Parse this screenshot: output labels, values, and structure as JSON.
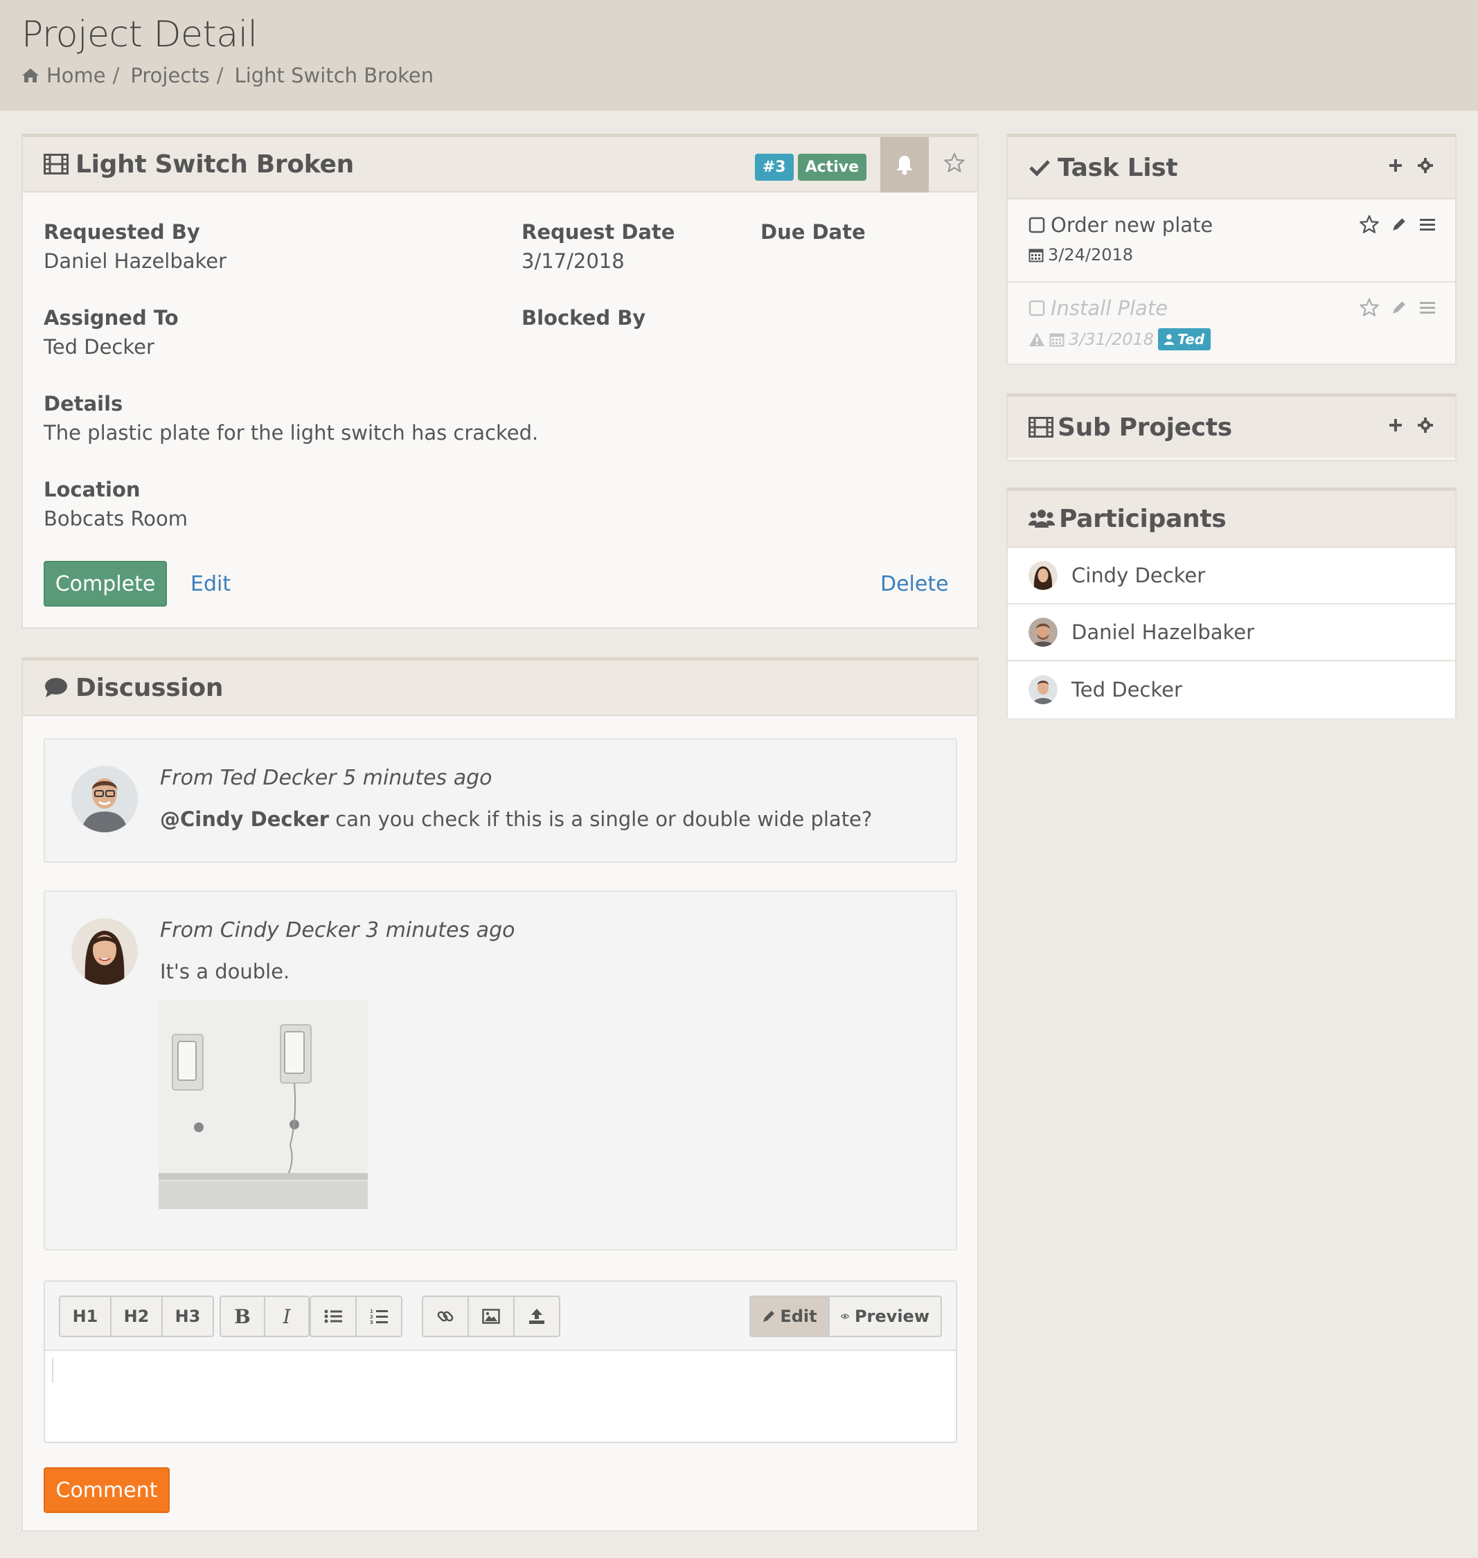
{
  "header": {
    "title": "Project Detail",
    "breadcrumb": [
      "Home",
      "Projects",
      "Light Switch Broken"
    ]
  },
  "project": {
    "title": "Light Switch Broken",
    "id_badge": "#3",
    "status": "Active",
    "fields": {
      "requested_by_label": "Requested By",
      "requested_by": "Daniel Hazelbaker",
      "request_date_label": "Request Date",
      "request_date": "3/17/2018",
      "due_date_label": "Due Date",
      "assigned_to_label": "Assigned To",
      "assigned_to": "Ted Decker",
      "blocked_by_label": "Blocked By",
      "details_label": "Details",
      "details": "The plastic plate for the light switch has cracked.",
      "location_label": "Location",
      "location": "Bobcats Room"
    },
    "actions": {
      "complete": "Complete",
      "edit": "Edit",
      "delete": "Delete"
    }
  },
  "discussion": {
    "title": "Discussion",
    "comments": [
      {
        "meta": "From Ted Decker 5 minutes ago",
        "mention": "@Cindy Decker",
        "text": " can you check if this is a single or double wide plate?"
      },
      {
        "meta": "From Cindy Decker 3 minutes ago",
        "text": "It's a double."
      }
    ],
    "editor": {
      "toolbar": [
        "H1",
        "H2",
        "H3",
        "B",
        "I"
      ],
      "edit_tab": "Edit",
      "preview_tab": "Preview"
    },
    "comment_button": "Comment"
  },
  "task_list": {
    "title": "Task List",
    "tasks": [
      {
        "name": "Order new plate",
        "date": "3/24/2018"
      },
      {
        "name": "Install Plate",
        "date": "3/31/2018",
        "assignee": "Ted"
      }
    ]
  },
  "sub_projects": {
    "title": "Sub Projects"
  },
  "participants": {
    "title": "Participants",
    "people": [
      "Cindy Decker",
      "Daniel Hazelbaker",
      "Ted Decker"
    ]
  },
  "colors": {
    "header_bg": "#ddd6cc",
    "complete_green": "#5a9a78",
    "badge_blue": "#3ea2bd",
    "comment_orange": "#f57a1f",
    "link_blue": "#3a7fbd"
  }
}
